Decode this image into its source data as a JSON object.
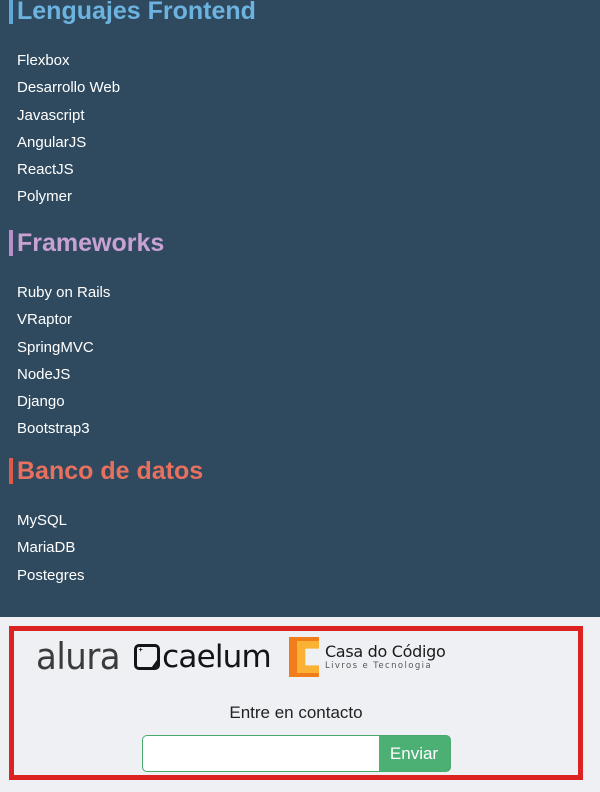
{
  "theme": {
    "background": "#2f4a5e",
    "footer_background": "#eef0f4",
    "highlight_border": "#dd2222",
    "link_color": "#ffffff",
    "button_color": "#4caf74"
  },
  "sections": [
    {
      "title": "Lenguajes Frontend",
      "title_color": "#6db3e0",
      "accent_color": "#5fa8d8",
      "items": [
        "Flexbox",
        "Desarrollo Web",
        "Javascript",
        "AngularJS",
        "ReactJS",
        "Polymer"
      ]
    },
    {
      "title": "Frameworks",
      "title_color": "#c9a2d4",
      "accent_color": "#b98fc9",
      "items": [
        "Ruby on Rails",
        "VRaptor",
        "SpringMVC",
        "NodeJS",
        "Django",
        "Bootstrap3"
      ]
    },
    {
      "title": "Banco de datos",
      "title_color": "#e8705f",
      "accent_color": "#e05a45",
      "items": [
        "MySQL",
        "MariaDB",
        "Postegres"
      ]
    }
  ],
  "footer": {
    "logos": [
      {
        "name": "alura",
        "text": "alura"
      },
      {
        "name": "caelum",
        "text": "caelum"
      },
      {
        "name": "casa-do-codigo",
        "title": "Casa do Código",
        "subtitle": "Livros e Tecnologia"
      }
    ],
    "contact_label": "Entre en contacto",
    "input_value": "",
    "input_placeholder": "",
    "submit_label": "Enviar"
  }
}
